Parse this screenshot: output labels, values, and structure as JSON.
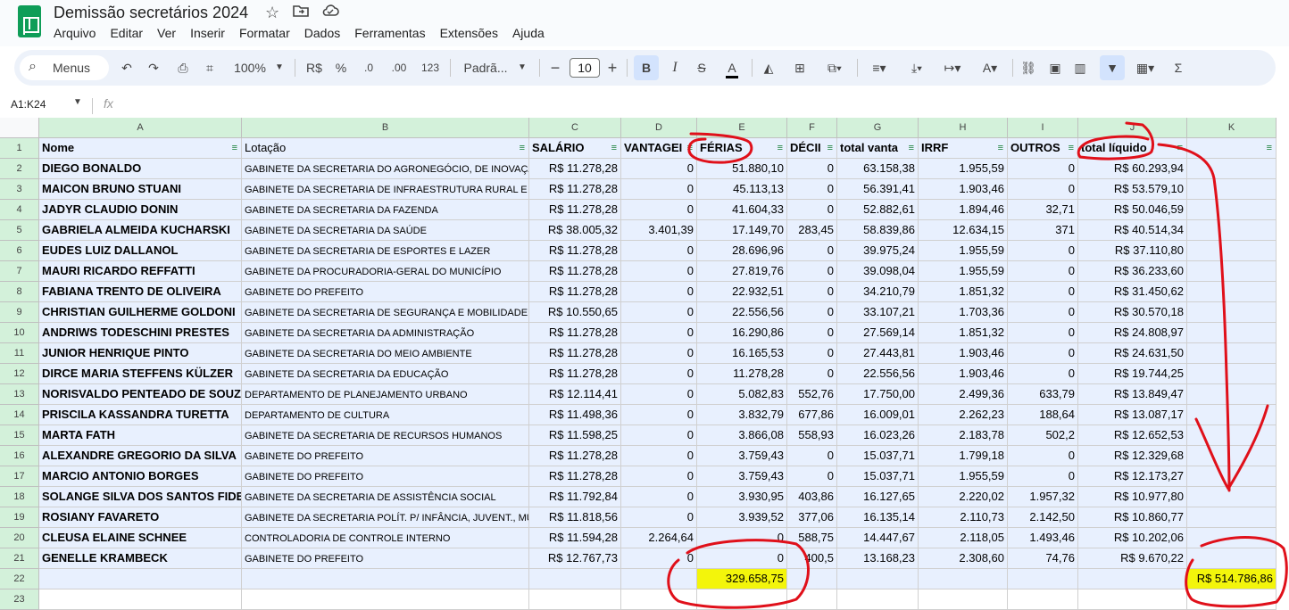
{
  "app": {
    "title": "Demissão secretários 2024",
    "menu": [
      "Arquivo",
      "Editar",
      "Ver",
      "Inserir",
      "Formatar",
      "Dados",
      "Ferramentas",
      "Extensões",
      "Ajuda"
    ]
  },
  "toolbar": {
    "search_label": "Menus",
    "zoom": "100%",
    "currency": "R$",
    "percent": "%",
    "dec_decrease": ".0",
    "dec_increase": ".00",
    "number_format": "123",
    "font": "Padrã...",
    "font_size": "10"
  },
  "formula_bar": {
    "name_box": "A1:K24",
    "fx": "fx",
    "content": ""
  },
  "columns": [
    "A",
    "B",
    "C",
    "D",
    "E",
    "F",
    "G",
    "H",
    "I",
    "J",
    "K"
  ],
  "row_numbers": [
    "1",
    "2",
    "3",
    "4",
    "5",
    "6",
    "7",
    "8",
    "9",
    "10",
    "11",
    "12",
    "13",
    "14",
    "15",
    "16",
    "17",
    "18",
    "19",
    "20",
    "21",
    "22",
    "23"
  ],
  "header_row": [
    "Nome",
    "Lotação",
    "SALÁRIO",
    "VANTAGEI",
    "FÉRIAS",
    "DÉCII",
    "total vanta",
    "IRRF",
    "OUTROS",
    "total líquido",
    ""
  ],
  "rows": [
    [
      "DIEGO BONALDO",
      "GABINETE DA SECRETARIA DO AGRONEGÓCIO, DE INOVAÇÃ",
      "R$ 11.278,28",
      "0",
      "51.880,10",
      "0",
      "63.158,38",
      "1.955,59",
      "0",
      "R$ 60.293,94"
    ],
    [
      "MAICON BRUNO STUANI",
      "GABINETE DA SECRETARIA DE INFRAESTRUTURA RURAL E UR",
      "R$ 11.278,28",
      "0",
      "45.113,13",
      "0",
      "56.391,41",
      "1.903,46",
      "0",
      "R$ 53.579,10"
    ],
    [
      "JADYR CLAUDIO DONIN",
      "GABINETE DA SECRETARIA DA FAZENDA",
      "R$ 11.278,28",
      "0",
      "41.604,33",
      "0",
      "52.882,61",
      "1.894,46",
      "32,71",
      "R$ 50.046,59"
    ],
    [
      "GABRIELA ALMEIDA KUCHARSKI",
      "GABINETE DA SECRETARIA DA SAÚDE",
      "R$ 38.005,32",
      "3.401,39",
      "17.149,70",
      "283,45",
      "58.839,86",
      "12.634,15",
      "371",
      "R$ 40.514,34"
    ],
    [
      "EUDES LUIZ DALLANOL",
      "GABINETE DA SECRETARIA DE ESPORTES E LAZER",
      "R$ 11.278,28",
      "0",
      "28.696,96",
      "0",
      "39.975,24",
      "1.955,59",
      "0",
      "R$ 37.110,80"
    ],
    [
      "MAURI RICARDO REFFATTI",
      "GABINETE DA PROCURADORIA-GERAL DO MUNICÍPIO",
      "R$ 11.278,28",
      "0",
      "27.819,76",
      "0",
      "39.098,04",
      "1.955,59",
      "0",
      "R$ 36.233,60"
    ],
    [
      "FABIANA TRENTO DE OLIVEIRA",
      "GABINETE DO PREFEITO",
      "R$ 11.278,28",
      "0",
      "22.932,51",
      "0",
      "34.210,79",
      "1.851,32",
      "0",
      "R$ 31.450,62"
    ],
    [
      "CHRISTIAN GUILHERME GOLDONI",
      "GABINETE DA SECRETARIA DE SEGURANÇA E MOBILIDADE U",
      "R$ 10.550,65",
      "0",
      "22.556,56",
      "0",
      "33.107,21",
      "1.703,36",
      "0",
      "R$ 30.570,18"
    ],
    [
      "ANDRIWS TODESCHINI PRESTES",
      "GABINETE DA SECRETARIA DA ADMINISTRAÇÃO",
      "R$ 11.278,28",
      "0",
      "16.290,86",
      "0",
      "27.569,14",
      "1.851,32",
      "0",
      "R$ 24.808,97"
    ],
    [
      "JUNIOR HENRIQUE PINTO",
      "GABINETE DA SECRETARIA DO MEIO AMBIENTE",
      "R$ 11.278,28",
      "0",
      "16.165,53",
      "0",
      "27.443,81",
      "1.903,46",
      "0",
      "R$ 24.631,50"
    ],
    [
      "DIRCE MARIA STEFFENS KÜLZER",
      "GABINETE DA SECRETARIA DA EDUCAÇÃO",
      "R$ 11.278,28",
      "0",
      "11.278,28",
      "0",
      "22.556,56",
      "1.903,46",
      "0",
      "R$ 19.744,25"
    ],
    [
      "NORISVALDO PENTEADO DE SOUZA",
      "DEPARTAMENTO DE PLANEJAMENTO URBANO",
      "R$ 12.114,41",
      "0",
      "5.082,83",
      "552,76",
      "17.750,00",
      "2.499,36",
      "633,79",
      "R$ 13.849,47"
    ],
    [
      "PRISCILA KASSANDRA TURETTA",
      "DEPARTAMENTO DE CULTURA",
      "R$ 11.498,36",
      "0",
      "3.832,79",
      "677,86",
      "16.009,01",
      "2.262,23",
      "188,64",
      "R$ 13.087,17"
    ],
    [
      "MARTA FATH",
      "GABINETE DA SECRETARIA DE RECURSOS HUMANOS",
      "R$ 11.598,25",
      "0",
      "3.866,08",
      "558,93",
      "16.023,26",
      "2.183,78",
      "502,2",
      "R$ 12.652,53"
    ],
    [
      "ALEXANDRE GREGORIO DA SILVA",
      "GABINETE DO PREFEITO",
      "R$ 11.278,28",
      "0",
      "3.759,43",
      "0",
      "15.037,71",
      "1.799,18",
      "0",
      "R$ 12.329,68"
    ],
    [
      "MARCIO ANTONIO BORGES",
      "GABINETE DO PREFEITO",
      "R$ 11.278,28",
      "0",
      "3.759,43",
      "0",
      "15.037,71",
      "1.955,59",
      "0",
      "R$ 12.173,27"
    ],
    [
      "SOLANGE SILVA DOS SANTOS FIDELIS",
      "GABINETE DA SECRETARIA DE ASSISTÊNCIA SOCIAL",
      "R$ 11.792,84",
      "0",
      "3.930,95",
      "403,86",
      "16.127,65",
      "2.220,02",
      "1.957,32",
      "R$ 10.977,80"
    ],
    [
      "ROSIANY FAVARETO",
      "GABINETE DA SECRETARIA POLÍT. P/ INFÂNCIA, JUVENT., MU",
      "R$ 11.818,56",
      "0",
      "3.939,52",
      "377,06",
      "16.135,14",
      "2.110,73",
      "2.142,50",
      "R$ 10.860,77"
    ],
    [
      "CLEUSA ELAINE SCHNEE",
      "CONTROLADORIA DE CONTROLE INTERNO",
      "R$ 11.594,28",
      "2.264,64",
      "0",
      "588,75",
      "14.447,67",
      "2.118,05",
      "1.493,46",
      "R$ 10.202,06"
    ],
    [
      "GENELLE KRAMBECK",
      "GABINETE DO PREFEITO",
      "R$ 12.767,73",
      "0",
      "0",
      "400,5",
      "13.168,23",
      "2.308,60",
      "74,76",
      "R$ 9.670,22"
    ]
  ],
  "totals": {
    "ferias_total": "329.658,75",
    "liquido_total": "R$ 514.786,86"
  },
  "colors": {
    "highlight": "#f3f50b",
    "annotation": "#e0101a",
    "header_green": "#d3f1da",
    "selection": "#e8f0fe"
  }
}
